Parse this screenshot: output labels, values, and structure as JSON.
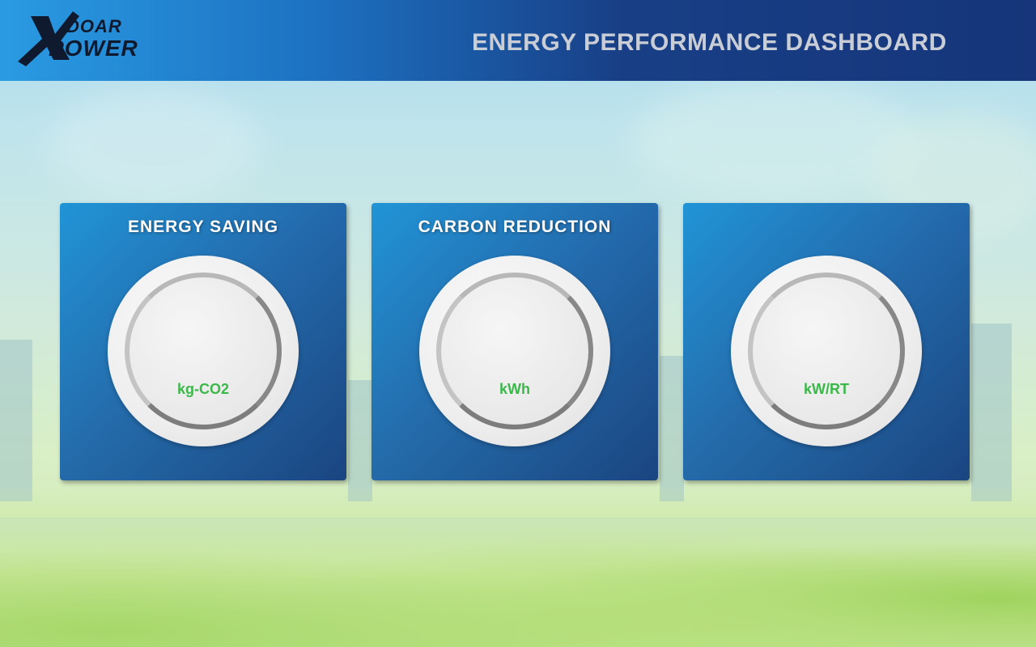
{
  "header": {
    "logo_text": "XDOAR POWER",
    "title": "ENERGY PERFORMANCE DASHBOARD"
  },
  "cards": [
    {
      "title": "ENERGY SAVING",
      "unit": "kg-CO2"
    },
    {
      "title": "CARBON REDUCTION",
      "unit": "kWh"
    },
    {
      "title": "",
      "unit": "kW/RT"
    }
  ],
  "colors": {
    "header_gradient_start": "#2a9be3",
    "header_gradient_end": "#16357a",
    "card_blue": "#1562aa",
    "unit_green": "#3cb84a",
    "title_gray": "#c9cdd6"
  }
}
